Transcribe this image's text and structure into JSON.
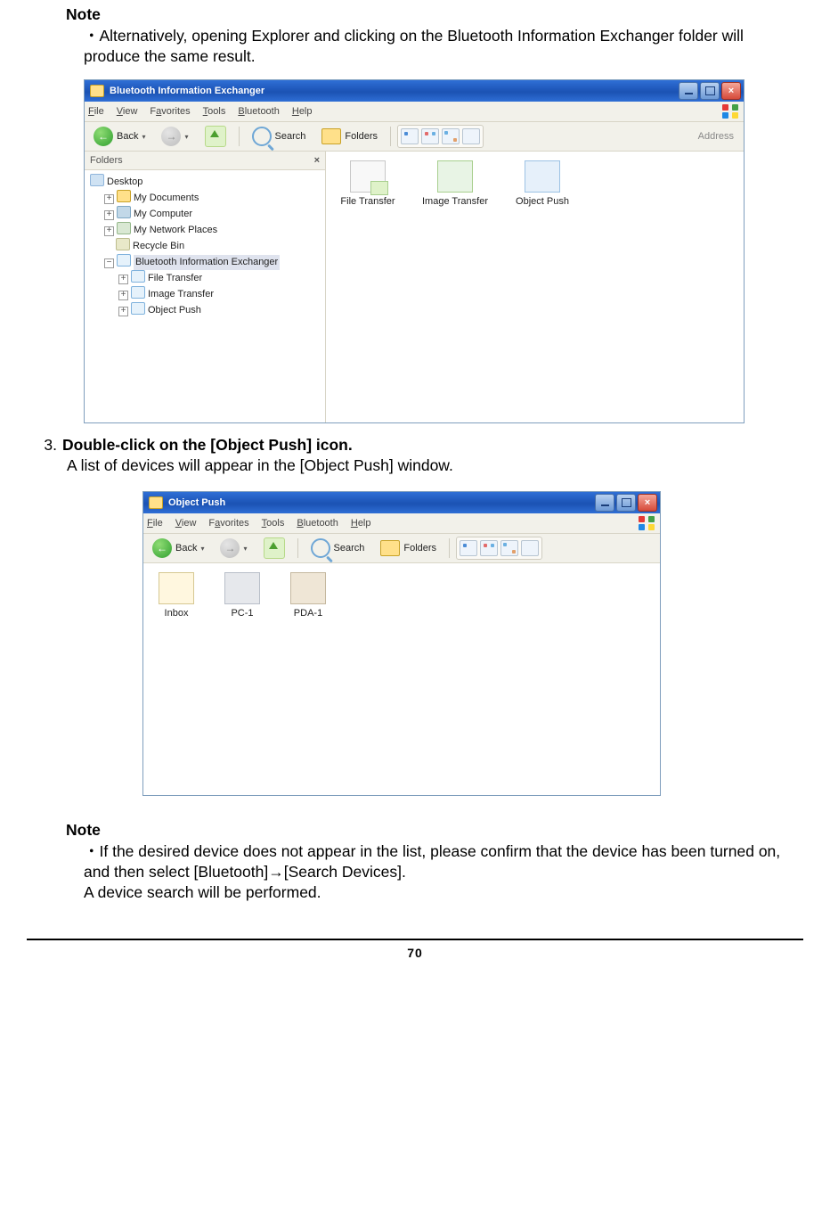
{
  "note1": {
    "heading": "Note",
    "text": "・Alternatively, opening Explorer and clicking on the Bluetooth Information Exchanger folder will produce the same result."
  },
  "window1": {
    "title": "Bluetooth Information Exchanger",
    "menus": {
      "file": "File",
      "view": "View",
      "favorites": "Favorites",
      "tools": "Tools",
      "bluetooth": "Bluetooth",
      "help": "Help"
    },
    "toolbar": {
      "back": "Back",
      "search": "Search",
      "folders": "Folders",
      "address": "Address"
    },
    "folders_label": "Folders",
    "tree": {
      "desktop": "Desktop",
      "mydocs": "My Documents",
      "mycomp": "My Computer",
      "mynet": "My Network Places",
      "recycle": "Recycle Bin",
      "btx": "Bluetooth Information Exchanger",
      "ft": "File Transfer",
      "it": "Image Transfer",
      "op": "Object Push"
    },
    "items": {
      "ft": "File Transfer",
      "it": "Image Transfer",
      "op": "Object Push"
    },
    "btn": {
      "min": "_",
      "close": "×"
    }
  },
  "step3": {
    "num": "3.",
    "title": "Double-click on the [Object Push] icon.",
    "body": "A list of devices will appear in the [Object Push] window."
  },
  "window2": {
    "title": "Object Push",
    "menus": {
      "file": "File",
      "view": "View",
      "favorites": "Favorites",
      "tools": "Tools",
      "bluetooth": "Bluetooth",
      "help": "Help"
    },
    "toolbar": {
      "back": "Back",
      "search": "Search",
      "folders": "Folders"
    },
    "items": {
      "inbox": "Inbox",
      "pc1": "PC-1",
      "pda1": "PDA-1"
    },
    "btn": {
      "min": "_",
      "close": "×"
    }
  },
  "note2": {
    "heading": "Note",
    "line1": "・If the desired device does not appear in the list, please confirm that the device has been turned on, and then select [Bluetooth]→[Search Devices].",
    "line2": "A device search will be performed."
  },
  "page_number": "70"
}
